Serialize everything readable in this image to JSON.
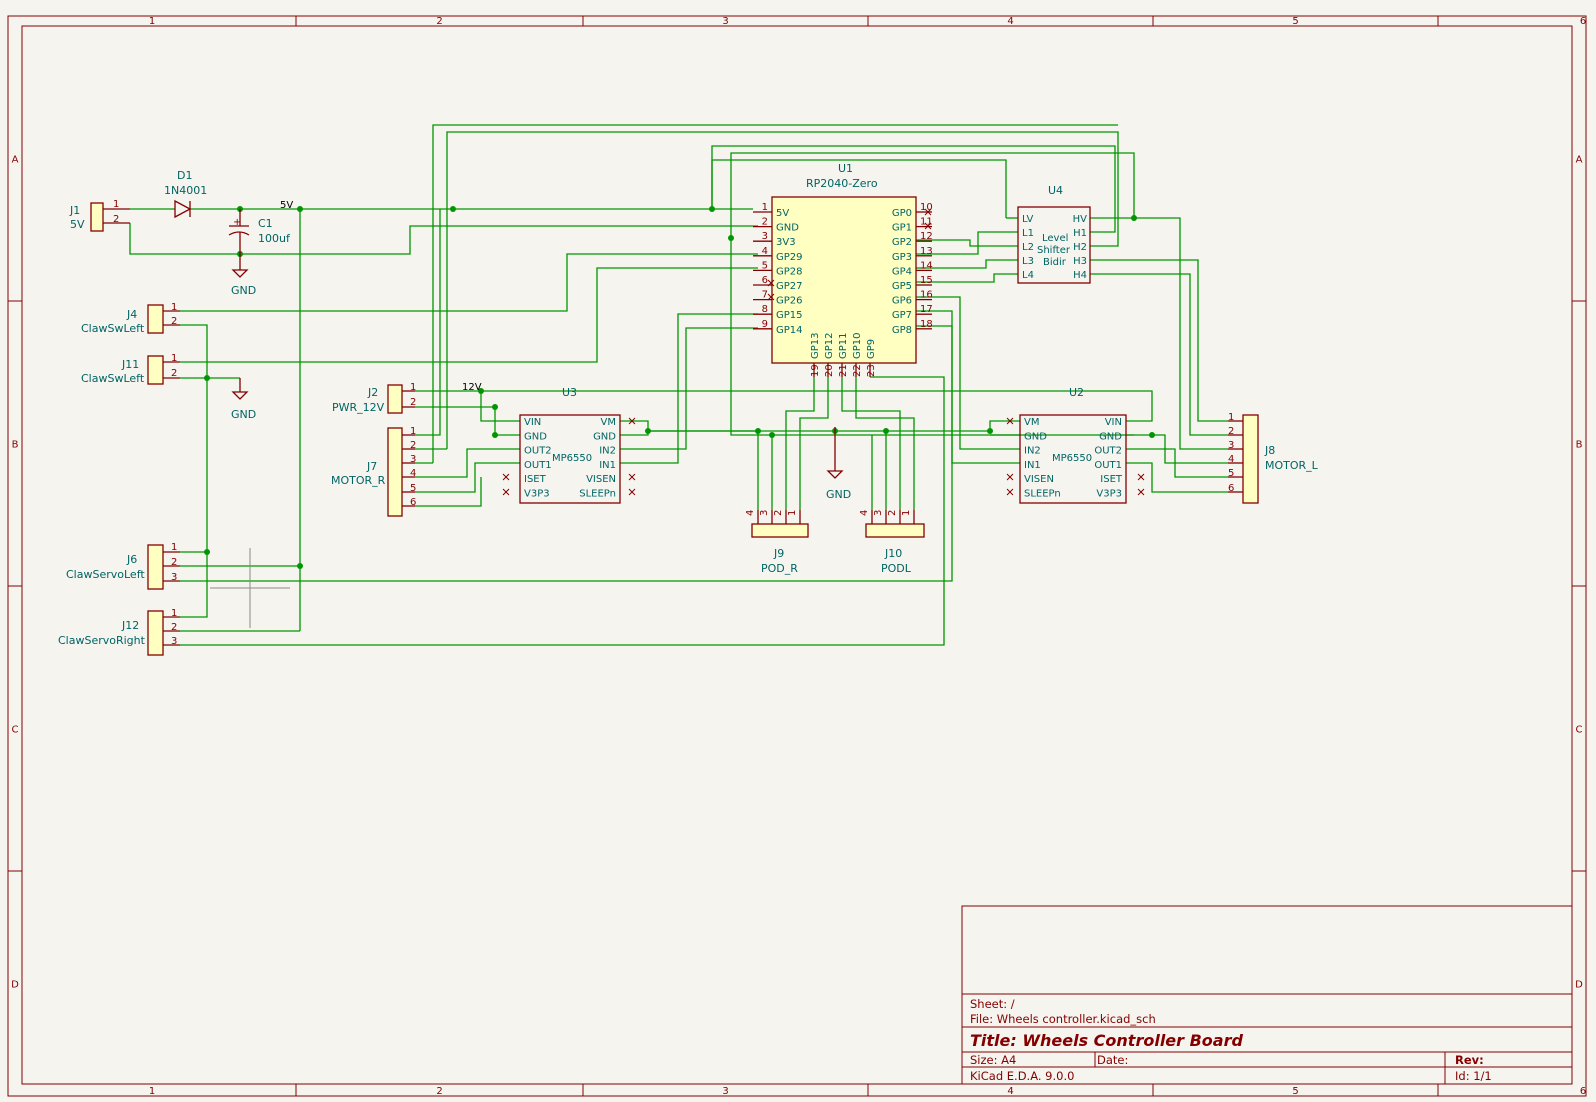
{
  "frame": {
    "col_labels": [
      "1",
      "2",
      "3",
      "4",
      "5",
      "6"
    ],
    "row_labels": [
      "A",
      "B",
      "C",
      "D"
    ]
  },
  "components": {
    "J1": {
      "ref": "J1",
      "value": "5V",
      "pins": [
        "1",
        "2"
      ]
    },
    "D1": {
      "ref": "D1",
      "value": "1N4001"
    },
    "C1": {
      "ref": "C1",
      "value": "100uf",
      "plus": "+"
    },
    "J4": {
      "ref": "J4",
      "value": "ClawSwLeft",
      "pins": [
        "1",
        "2"
      ]
    },
    "J11": {
      "ref": "J11",
      "value": "ClawSwLeft",
      "pins": [
        "1",
        "2"
      ]
    },
    "J2": {
      "ref": "J2",
      "value": "PWR_12V",
      "pins": [
        "1",
        "2"
      ]
    },
    "J7": {
      "ref": "J7",
      "value": "MOTOR_R",
      "pins": [
        "1",
        "2",
        "3",
        "4",
        "5",
        "6"
      ]
    },
    "J6": {
      "ref": "J6",
      "value": "ClawServoLeft",
      "pins": [
        "1",
        "2",
        "3"
      ]
    },
    "J12": {
      "ref": "J12",
      "value": "ClawServoRight",
      "pins": [
        "1",
        "2",
        "3"
      ]
    },
    "U1": {
      "ref": "U1",
      "value": "RP2040-Zero",
      "left_pins": [
        {
          "num": "1",
          "name": "5V"
        },
        {
          "num": "2",
          "name": "GND"
        },
        {
          "num": "3",
          "name": "3V3"
        },
        {
          "num": "4",
          "name": "GP29"
        },
        {
          "num": "5",
          "name": "GP28"
        },
        {
          "num": "6",
          "name": "GP27"
        },
        {
          "num": "7",
          "name": "GP26"
        },
        {
          "num": "8",
          "name": "GP15"
        },
        {
          "num": "9",
          "name": "GP14"
        }
      ],
      "right_pins": [
        {
          "num": "10",
          "name": "GP0"
        },
        {
          "num": "11",
          "name": "GP1"
        },
        {
          "num": "12",
          "name": "GP2"
        },
        {
          "num": "13",
          "name": "GP3"
        },
        {
          "num": "14",
          "name": "GP4"
        },
        {
          "num": "15",
          "name": "GP5"
        },
        {
          "num": "16",
          "name": "GP6"
        },
        {
          "num": "17",
          "name": "GP7"
        },
        {
          "num": "18",
          "name": "GP8"
        }
      ],
      "bottom_pins": [
        {
          "num": "19",
          "name": "GP13"
        },
        {
          "num": "20",
          "name": "GP12"
        },
        {
          "num": "21",
          "name": "GP11"
        },
        {
          "num": "22",
          "name": "GP10"
        },
        {
          "num": "23",
          "name": "GP9"
        }
      ]
    },
    "U4": {
      "ref": "U4",
      "value": "Level Shifter Bidir",
      "body_lines": [
        "Level",
        "Shifter",
        "Bidir"
      ],
      "left_pins": [
        "LV",
        "L1",
        "L2",
        "L3",
        "L4"
      ],
      "right_pins": [
        "HV",
        "H1",
        "H2",
        "H3",
        "H4"
      ]
    },
    "U3": {
      "ref": "U3",
      "value": "MP6550",
      "left_pins": [
        "VIN",
        "GND",
        "OUT2",
        "OUT1",
        "ISET",
        "V3P3"
      ],
      "right_pins": [
        "VM",
        "GND",
        "IN2",
        "IN1",
        "VISEN",
        "SLEEPn"
      ]
    },
    "U2": {
      "ref": "U2",
      "value": "MP6550",
      "left_pins": [
        "VM",
        "GND",
        "IN2",
        "IN1",
        "VISEN",
        "SLEEPn"
      ],
      "right_pins": [
        "VIN",
        "GND",
        "OUT2",
        "OUT1",
        "ISET",
        "V3P3"
      ]
    },
    "J8": {
      "ref": "J8",
      "value": "MOTOR_L",
      "pins": [
        "1",
        "2",
        "3",
        "4",
        "5",
        "6"
      ]
    },
    "J9": {
      "ref": "J9",
      "value": "POD_R",
      "pins": [
        "4",
        "3",
        "2",
        "1"
      ]
    },
    "J10": {
      "ref": "J10",
      "value": "PODL",
      "pins": [
        "4",
        "3",
        "2",
        "1"
      ]
    }
  },
  "nets": {
    "five_v": "5V",
    "twelve_v": "12V",
    "gnd": "GND"
  },
  "title_block": {
    "sheet": "Sheet: /",
    "file": "File: Wheels controller.kicad_sch",
    "title": "Title: Wheels Controller Board",
    "size": "Size: A4",
    "date": "Date:",
    "rev": "Rev:",
    "tool": "KiCad E.D.A. 9.0.0",
    "id": "Id: 1/1"
  }
}
